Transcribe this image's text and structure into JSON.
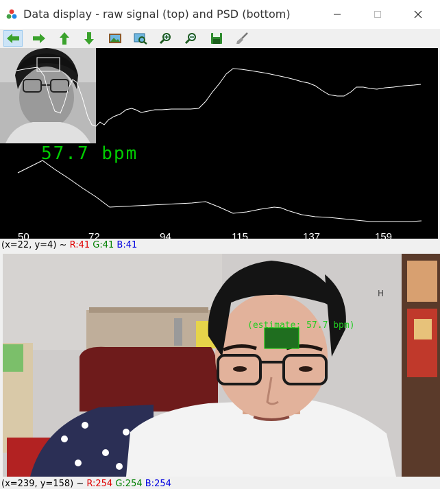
{
  "window": {
    "title": "Data display - raw signal (top) and PSD (bottom)",
    "icon": "opencv-window-icon",
    "controls": [
      "minimize-icon",
      "maximize-icon",
      "close-icon"
    ]
  },
  "toolbar": {
    "buttons": [
      {
        "name": "pan-left",
        "icon": "arrow-left-icon"
      },
      {
        "name": "pan-right",
        "icon": "arrow-right-icon"
      },
      {
        "name": "pan-up",
        "icon": "arrow-up-icon"
      },
      {
        "name": "pan-down",
        "icon": "arrow-down-icon"
      },
      {
        "name": "zoom-original",
        "icon": "picture-icon"
      },
      {
        "name": "zoom-fit",
        "icon": "zoom-fit-icon"
      },
      {
        "name": "zoom-in",
        "icon": "zoom-in-icon"
      },
      {
        "name": "zoom-out",
        "icon": "zoom-out-icon"
      },
      {
        "name": "save",
        "icon": "save-icon"
      },
      {
        "name": "properties",
        "icon": "brush-icon"
      }
    ]
  },
  "plot": {
    "bpm_text": "57.7 bpm",
    "x_ticks": [
      "50",
      "72",
      "94",
      "115",
      "137",
      "159"
    ],
    "colors": {
      "background": "#000000",
      "trace": "#ffffff",
      "bpm": "#00cc00"
    }
  },
  "status_top": {
    "prefix": "(x=22, y=4) ~",
    "r": "R:41",
    "g": "G:41",
    "b": "B:41"
  },
  "camera": {
    "estimate_label": "(estimate: 57.7 bpm)",
    "roi_color": "#00aa00"
  },
  "status_bottom": {
    "prefix": "(x=239, y=158) ~",
    "r": "R:254",
    "g": "G:254",
    "b": "B:254"
  }
}
